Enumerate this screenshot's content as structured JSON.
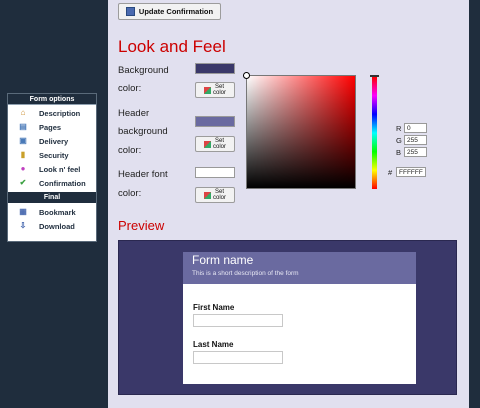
{
  "toolbar": {
    "update_label": "Update Confirmation"
  },
  "sidebar": {
    "header": "Form options",
    "items": [
      {
        "label": "Description",
        "icon": "house-icon"
      },
      {
        "label": "Pages",
        "icon": "pages-icon"
      },
      {
        "label": "Delivery",
        "icon": "delivery-icon"
      },
      {
        "label": "Security",
        "icon": "lock-icon"
      },
      {
        "label": "Look n' feel",
        "icon": "palette-icon"
      },
      {
        "label": "Confirmation",
        "icon": "check-icon"
      }
    ],
    "final_header": "Final",
    "final_items": [
      {
        "label": "Bookmark",
        "icon": "bookmark-icon"
      },
      {
        "label": "Download",
        "icon": "download-icon"
      }
    ]
  },
  "look_and_feel": {
    "title": "Look and Feel",
    "background_color_label_1": "Background",
    "background_color_label_2": "color:",
    "header_bg_label_1": "Header",
    "header_bg_label_2": "background",
    "header_bg_label_3": "color:",
    "header_font_label_1": "Header font",
    "header_font_label_2": "color:",
    "set_color_label_1": "Set",
    "set_color_label_2": "color",
    "swatches": {
      "background": "#3a3869",
      "header_background": "#6a6aa0",
      "header_font": "#ffffff"
    }
  },
  "color_picker": {
    "r_label": "R",
    "g_label": "G",
    "b_label": "B",
    "hex_label": "#",
    "r_value": "0",
    "g_value": "255",
    "b_value": "255",
    "hex_value": "FFFFFF"
  },
  "preview": {
    "title": "Preview",
    "form_name": "Form name",
    "form_description": "This is a short description of the form",
    "field_1_label": "First Name",
    "field_2_label": "Last Name"
  },
  "colors": {
    "accent_red": "#cc0000",
    "navy": "#1f2d3d",
    "main_bg": "#e1e0ef"
  }
}
